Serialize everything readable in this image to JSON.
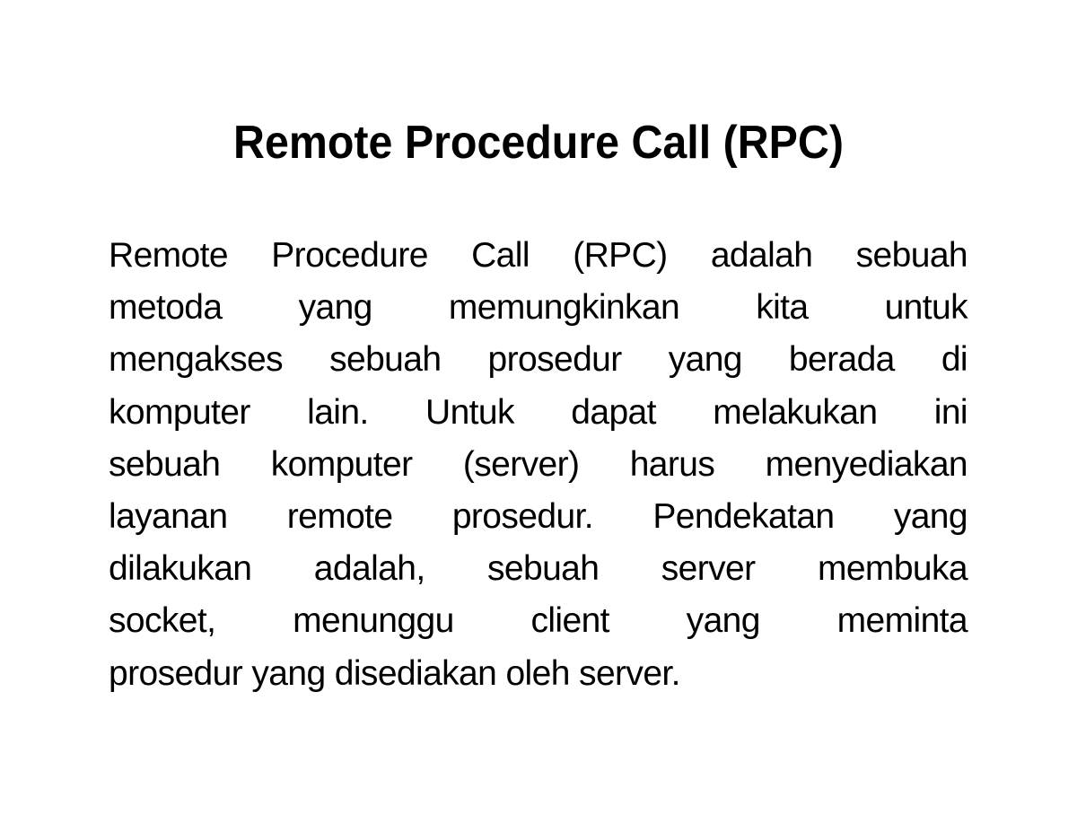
{
  "slide": {
    "title": "Remote Procedure Call (RPC)",
    "body_lines": [
      "Remote Procedure Call (RPC) adalah sebuah",
      "metoda yang memungkinkan kita untuk",
      "mengakses sebuah prosedur yang berada di",
      "komputer lain. Untuk dapat melakukan ini",
      "sebuah komputer (server) harus menyediakan",
      "layanan remote prosedur. Pendekatan yang",
      "dilakukan adalah, sebuah server membuka",
      "socket, menunggu client yang meminta",
      "prosedur yang disediakan oleh server."
    ]
  }
}
